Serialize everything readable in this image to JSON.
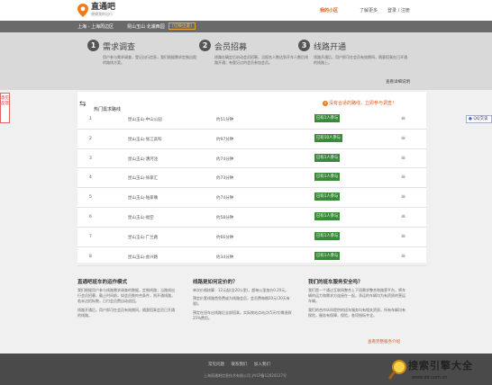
{
  "header": {
    "logo_title": "直通吧",
    "logo_sub": "便捷我的出行",
    "nav_current": "我的小区",
    "nav_about": "了解更多",
    "nav_login": "登录 / 注册"
  },
  "citybar": {
    "city_route": "上海 - 上海周边区",
    "selected_area": "昆山玉山 北浦西园",
    "switch_label": "[切换位置]"
  },
  "steps": [
    {
      "num": "1",
      "title": "需求调查",
      "desc": "用户参与需求调查，登记出行信息，我们根据需求定制出租的路线方案。"
    },
    {
      "num": "2",
      "title": "会员招募",
      "desc": "线路在确定后启动会员招募，当报名人数达到开车人数后线路开通；有登记过的会员参加会员。"
    },
    {
      "num": "3",
      "title": "线路开通",
      "desc": "线路开通后，用户即可在会员有效期间，随意搭乘在已开通的线路上。"
    }
  ],
  "hero_link": "查看详细说明",
  "side_tab": "意见反馈",
  "qq_label": "QQ交谈",
  "hot": {
    "title": "热门需求路线",
    "alert": "没有合适的路线，立即参与调查！",
    "rows": [
      {
        "num": "1",
        "route": "昆山玉山-中山公园",
        "time": "约51分钟",
        "badge": "已有1人参与",
        "more": "≡"
      },
      {
        "num": "2",
        "route": "昆山玉山-张江高科",
        "time": "约97分钟",
        "badge": "已有10人参与",
        "more": "≡"
      },
      {
        "num": "3",
        "route": "昆山玉山-漕河泾",
        "time": "约74分钟",
        "badge": "已有1人参与",
        "more": "≡"
      },
      {
        "num": "4",
        "route": "昆山玉山-徐家汇",
        "time": "约73分钟",
        "badge": "已有1人参与",
        "more": "≡"
      },
      {
        "num": "5",
        "route": "昆山玉山-陆家嘴",
        "time": "约74分钟",
        "badge": "已有1人参与",
        "more": "≡"
      },
      {
        "num": "6",
        "route": "昆山玉山-福空",
        "time": "约58分钟",
        "badge": "已有1人参与",
        "more": "≡"
      },
      {
        "num": "7",
        "route": "昆山玉山-广兰路",
        "time": "约66分钟",
        "badge": "已有1人参与",
        "more": "≡"
      },
      {
        "num": "8",
        "route": "昆山玉山-会兴路",
        "time": "约34分钟",
        "badge": "已有1人参与",
        "more": "≡"
      }
    ]
  },
  "info": {
    "col1": {
      "title": "直通吧班车的运作模式",
      "p1": "我们根据用户参与线路需求调查的数据，定制线路；当路线出行会员招募，截止时间前，如会员数符合条件，则开通线路，若未达招标数，已付会员费自动退回。",
      "p2": "线路开通后，用户即可在会员有效期间，随意搭乘会员已开通的线路。"
    },
    "col2": {
      "title": "线路是如何定价的？",
      "p1": "单次价格核算：12元起(含20公里)，超每公里加价0.20元。",
      "p2": "预定价套线路首免费或为线路会员，会员费每期20元(30天有限)。",
      "p3": "预定在班车出线路后全部搭乘，实际按站点站点(5天内)需退款25%费用。"
    },
    "col3": {
      "title": "我们的班车服务安全吗？",
      "p1": "我们是一个通过互联网整合上下班需求整合和路营平台，将车辆的运力和需求方连接在一起，承运的车辆均为有资质的营运车辆。",
      "p2": "我们的合作伙伴提供的班车服务均有相关资质，所有车辆均有保险，服务有保障，保险，各项指标齐全。"
    },
    "more_link": "查看完整服务介绍"
  },
  "footer": {
    "links": [
      "常见问题",
      "联系我们",
      "加入我们"
    ],
    "copyright": "上海直通吧信息技术有限公司 沪ICP备12020127号"
  },
  "watermark": {
    "text": "搜索引擎大全",
    "sub": "www.dir.com.cn"
  },
  "colors": {
    "accent": "#e05a1a",
    "badge_green": "#3a8a3a",
    "citybar": "#6a6a6a",
    "hero_bg": "#d9d9d9",
    "footer_bg": "#4a4a4a"
  }
}
